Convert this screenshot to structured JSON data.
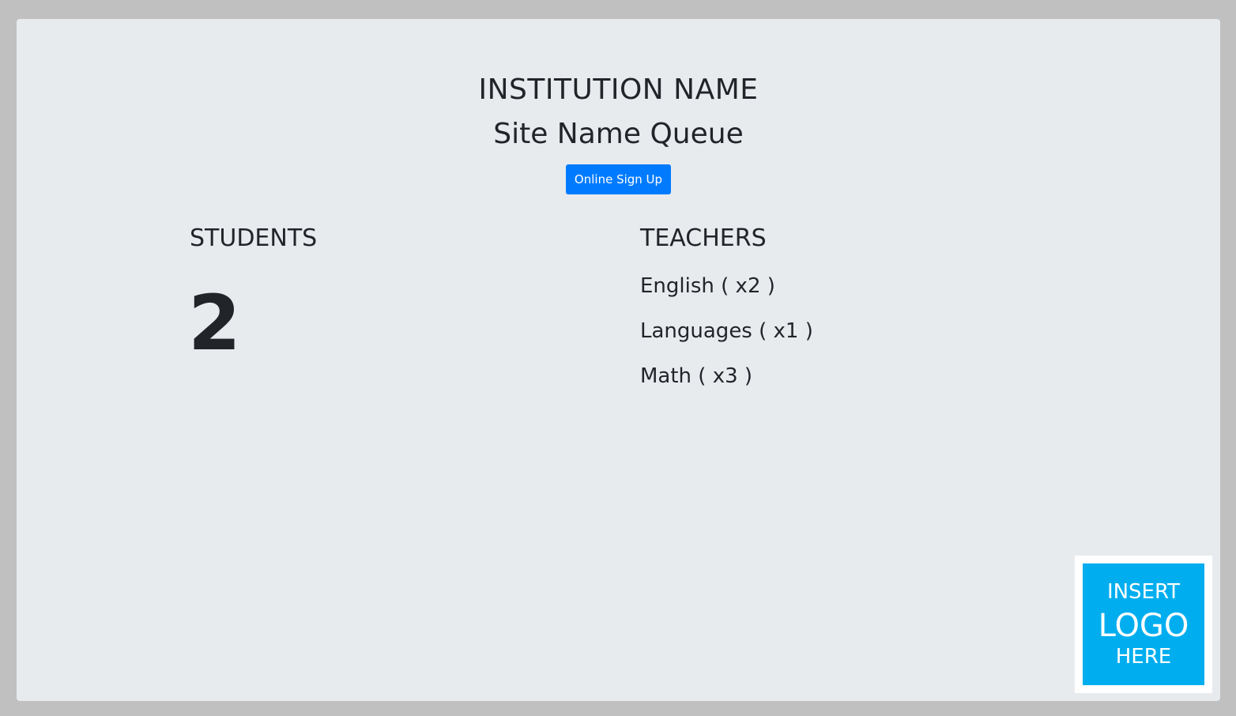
{
  "header": {
    "institution_name": "INSTITUTION NAME",
    "site_name": "Site Name Queue",
    "signup_label": "Online Sign Up"
  },
  "students": {
    "heading": "STUDENTS",
    "count": "2"
  },
  "teachers": {
    "heading": "TEACHERS",
    "items": [
      {
        "label": "English ( x2 )"
      },
      {
        "label": "Languages ( x1 )"
      },
      {
        "label": "Math ( x3 )"
      }
    ]
  },
  "logo": {
    "line1": "INSERT",
    "line2": "LOGO",
    "line3": "HERE"
  },
  "colors": {
    "accent": "#007bff",
    "logo_bg": "#00aeef",
    "panel_bg": "#e8ebee",
    "page_bg": "#c0c0c0"
  }
}
